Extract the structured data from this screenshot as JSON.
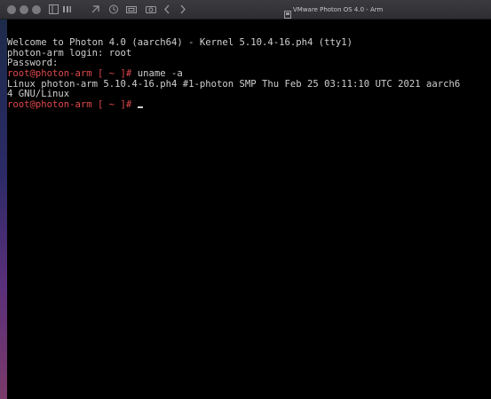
{
  "window": {
    "title": "VMware Photon OS 4.0 - Arm"
  },
  "toolbar": {
    "icons": [
      "sidebar-icon",
      "settings-icon",
      "back-icon",
      "snapshot-icon",
      "folder-icon",
      "chevron-left-icon",
      "chevron-right-icon"
    ]
  },
  "terminal": {
    "line1": "Welcome to Photon 4.0 (aarch64) - Kernel 5.10.4-16.ph4 (tty1)",
    "line2": "photon-arm login: root",
    "line3": "Password:",
    "prompt1": "root@photon-arm [ ~ ]#",
    "command1": " uname -a",
    "output1a": "Linux photon-arm 5.10.4-16.ph4 #1-photon SMP Thu Feb 25 03:11:10 UTC 2021 aarch6",
    "output1b": "4 GNU/Linux",
    "prompt2": "root@photon-arm [ ~ ]#",
    "command2": " "
  },
  "colors": {
    "prompt": "#e0484c",
    "text": "#cfcfcf",
    "background": "#000000"
  }
}
